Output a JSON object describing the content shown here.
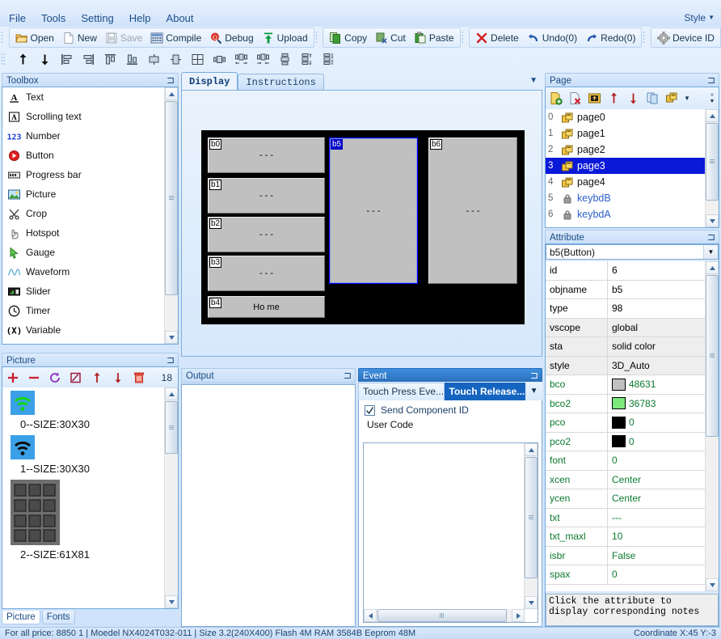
{
  "menu": {
    "items": [
      "File",
      "Tools",
      "Setting",
      "Help",
      "About"
    ],
    "style_label": "Style"
  },
  "toolbar": {
    "groups": [
      {
        "buttons": [
          {
            "label": "Open",
            "icon": "open-folder-icon",
            "disabled": false
          },
          {
            "label": "New",
            "icon": "new-file-icon",
            "disabled": false
          },
          {
            "label": "Save",
            "icon": "save-disk-icon",
            "disabled": true
          },
          {
            "label": "Compile",
            "icon": "compile-icon",
            "disabled": false
          },
          {
            "label": "Debug",
            "icon": "debug-icon",
            "disabled": false
          },
          {
            "label": "Upload",
            "icon": "upload-icon",
            "disabled": false
          }
        ]
      },
      {
        "buttons": [
          {
            "label": "Copy",
            "icon": "copy-icon",
            "disabled": false
          },
          {
            "label": "Cut",
            "icon": "cut-icon",
            "disabled": false
          },
          {
            "label": "Paste",
            "icon": "paste-icon",
            "disabled": false
          }
        ]
      },
      {
        "buttons": [
          {
            "label": "Delete",
            "icon": "delete-x-icon",
            "disabled": false
          },
          {
            "label": "Undo(0)",
            "icon": "undo-icon",
            "disabled": false
          },
          {
            "label": "Redo(0)",
            "icon": "redo-icon",
            "disabled": false
          }
        ]
      },
      {
        "buttons": [
          {
            "label": "Device ID",
            "icon": "gear-icon",
            "disabled": false
          }
        ]
      }
    ],
    "align_icons": [
      "move-up-icon",
      "move-down-icon",
      "align-left-icon",
      "align-right-icon",
      "align-top-icon",
      "align-bottom-icon",
      "center-horizontal-icon",
      "center-vertical-icon",
      "fit-screen-icon",
      "same-width-icon",
      "spread-horizontal-icon",
      "shrink-horizontal-icon",
      "same-height-icon",
      "spread-vertical-icon",
      "shrink-vertical-icon"
    ]
  },
  "toolbox": {
    "title": "Toolbox",
    "items": [
      {
        "label": "Text",
        "icon": "text-icon"
      },
      {
        "label": "Scrolling text",
        "icon": "scrolling-text-icon"
      },
      {
        "label": "Number",
        "icon": "number-icon"
      },
      {
        "label": "Button",
        "icon": "button-icon"
      },
      {
        "label": "Progress bar",
        "icon": "progress-bar-icon"
      },
      {
        "label": "Picture",
        "icon": "picture-icon"
      },
      {
        "label": "Crop",
        "icon": "crop-icon"
      },
      {
        "label": "Hotspot",
        "icon": "hotspot-icon"
      },
      {
        "label": "Gauge",
        "icon": "gauge-icon"
      },
      {
        "label": "Waveform",
        "icon": "waveform-icon"
      },
      {
        "label": "Slider",
        "icon": "slider-icon"
      },
      {
        "label": "Timer",
        "icon": "timer-icon"
      },
      {
        "label": "Variable",
        "icon": "variable-icon"
      }
    ]
  },
  "picture_panel": {
    "title": "Picture",
    "count": "18",
    "toolbar_icons": [
      "add-icon",
      "remove-icon",
      "refresh-icon",
      "edit-icon",
      "move-up-icon",
      "move-down-icon",
      "trash-icon"
    ],
    "items": [
      {
        "caption": "0--SIZE:30X30",
        "thumb": "wifi-green-icon"
      },
      {
        "caption": "1--SIZE:30X30",
        "thumb": "wifi-black-icon"
      },
      {
        "caption": "2--SIZE:61X81",
        "thumb": "keypad-icon"
      }
    ],
    "tabs": [
      {
        "label": "Picture",
        "selected": true
      },
      {
        "label": "Fonts",
        "selected": false
      }
    ]
  },
  "editor": {
    "tabs": [
      {
        "label": "Display",
        "selected": true
      },
      {
        "label": "Instructions",
        "selected": false
      }
    ],
    "canvas": {
      "widgets": [
        {
          "tag": "b0",
          "text": "- - -",
          "selected": false
        },
        {
          "tag": "b1",
          "text": "- - -",
          "selected": false
        },
        {
          "tag": "b2",
          "text": "- - -",
          "selected": false
        },
        {
          "tag": "b3",
          "text": "- - -",
          "selected": false
        },
        {
          "tag": "b4",
          "text": "Ho me",
          "selected": false
        },
        {
          "tag": "b5",
          "text": "- - -",
          "selected": true
        },
        {
          "tag": "b6",
          "text": "- - -",
          "selected": false
        }
      ]
    }
  },
  "output": {
    "title": "Output",
    "content": ""
  },
  "event": {
    "title": "Event",
    "tabs": [
      {
        "label": "Touch Press Eve...",
        "selected": false
      },
      {
        "label": "Touch Release...",
        "selected": true
      }
    ],
    "send_component_id": {
      "label": "Send Component ID",
      "checked": true
    },
    "user_code_label": "User Code",
    "user_code": ""
  },
  "page_panel": {
    "title": "Page",
    "toolbar_icons": [
      "add-page-icon",
      "delete-page-icon",
      "import-page-icon",
      "move-up-icon",
      "move-down-icon",
      "copy-page-icon",
      "page-group-icon",
      "chevron-down-icon"
    ],
    "rows": [
      {
        "index": "0",
        "name": "page0",
        "locked": false,
        "selected": false
      },
      {
        "index": "1",
        "name": "page1",
        "locked": false,
        "selected": false
      },
      {
        "index": "2",
        "name": "page2",
        "locked": false,
        "selected": false
      },
      {
        "index": "3",
        "name": "page3",
        "locked": false,
        "selected": true
      },
      {
        "index": "4",
        "name": "page4",
        "locked": false,
        "selected": false
      },
      {
        "index": "5",
        "name": "keybdB",
        "locked": true,
        "selected": false
      },
      {
        "index": "6",
        "name": "keybdA",
        "locked": true,
        "selected": false
      }
    ]
  },
  "attribute": {
    "title": "Attribute",
    "selected_object": "b5(Button)",
    "rows": [
      {
        "key": "id",
        "value": "6",
        "kind": "plain"
      },
      {
        "key": "objname",
        "value": "b5",
        "kind": "plain"
      },
      {
        "key": "type",
        "value": "98",
        "kind": "plain"
      },
      {
        "key": "vscope",
        "value": "global",
        "kind": "readonly"
      },
      {
        "key": "sta",
        "value": "solid color",
        "kind": "readonly"
      },
      {
        "key": "style",
        "value": "3D_Auto",
        "kind": "readonly"
      },
      {
        "key": "bco",
        "value": "48631",
        "kind": "color",
        "swatch": "#c0c0c0"
      },
      {
        "key": "bco2",
        "value": "36783",
        "kind": "color",
        "swatch": "#7ce87c"
      },
      {
        "key": "pco",
        "value": "0",
        "kind": "color",
        "swatch": "#000000"
      },
      {
        "key": "pco2",
        "value": "0",
        "kind": "color",
        "swatch": "#000000"
      },
      {
        "key": "font",
        "value": "0",
        "kind": "edit"
      },
      {
        "key": "xcen",
        "value": "Center",
        "kind": "edit"
      },
      {
        "key": "ycen",
        "value": "Center",
        "kind": "edit"
      },
      {
        "key": "txt",
        "value": "---",
        "kind": "edit"
      },
      {
        "key": "txt_maxl",
        "value": "10",
        "kind": "edit"
      },
      {
        "key": "isbr",
        "value": "False",
        "kind": "edit"
      },
      {
        "key": "spax",
        "value": "0",
        "kind": "edit"
      }
    ],
    "notes": "Click the attribute to\ndisplay corresponding notes"
  },
  "status_bar": {
    "segments": [
      "For all price:  8850 1 | Moedel NX4024T032-011 | Size 3.2(240X400) Flash 4M RAM 3584B Eeprom 48M",
      "Coordinate X:45  Y:-3"
    ]
  }
}
